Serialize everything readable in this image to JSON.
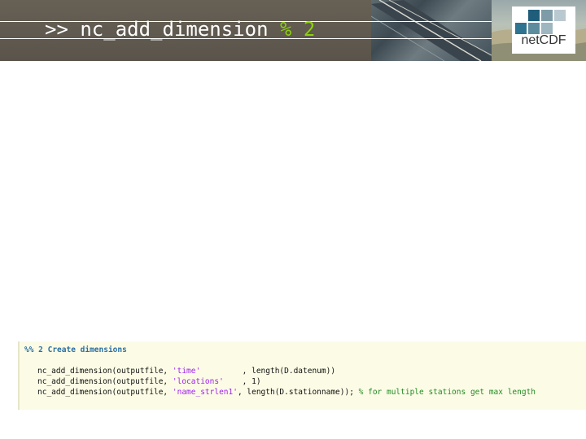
{
  "slide": {
    "title_command": ">> nc_add_dimension",
    "title_comment": "% 2"
  },
  "logo": {
    "text": "netCDF"
  },
  "code": {
    "cell_title": "%% 2 Create dimensions",
    "line1": {
      "call": "nc_add_dimension(outputfile, ",
      "arg": "'time'",
      "rest": "         , length(D.datenum))"
    },
    "line2": {
      "call": "nc_add_dimension(outputfile, ",
      "arg": "'locations'",
      "rest": "    , 1)"
    },
    "line3": {
      "call": "nc_add_dimension(outputfile, ",
      "arg": "'name_strlen1'",
      "rest": ", length(D.stationname)); ",
      "comment": "% for multiple stations get max length"
    }
  },
  "colors": {
    "accent": "#8bd10b",
    "header": "#666055",
    "code_bg": "#fcfce6"
  }
}
